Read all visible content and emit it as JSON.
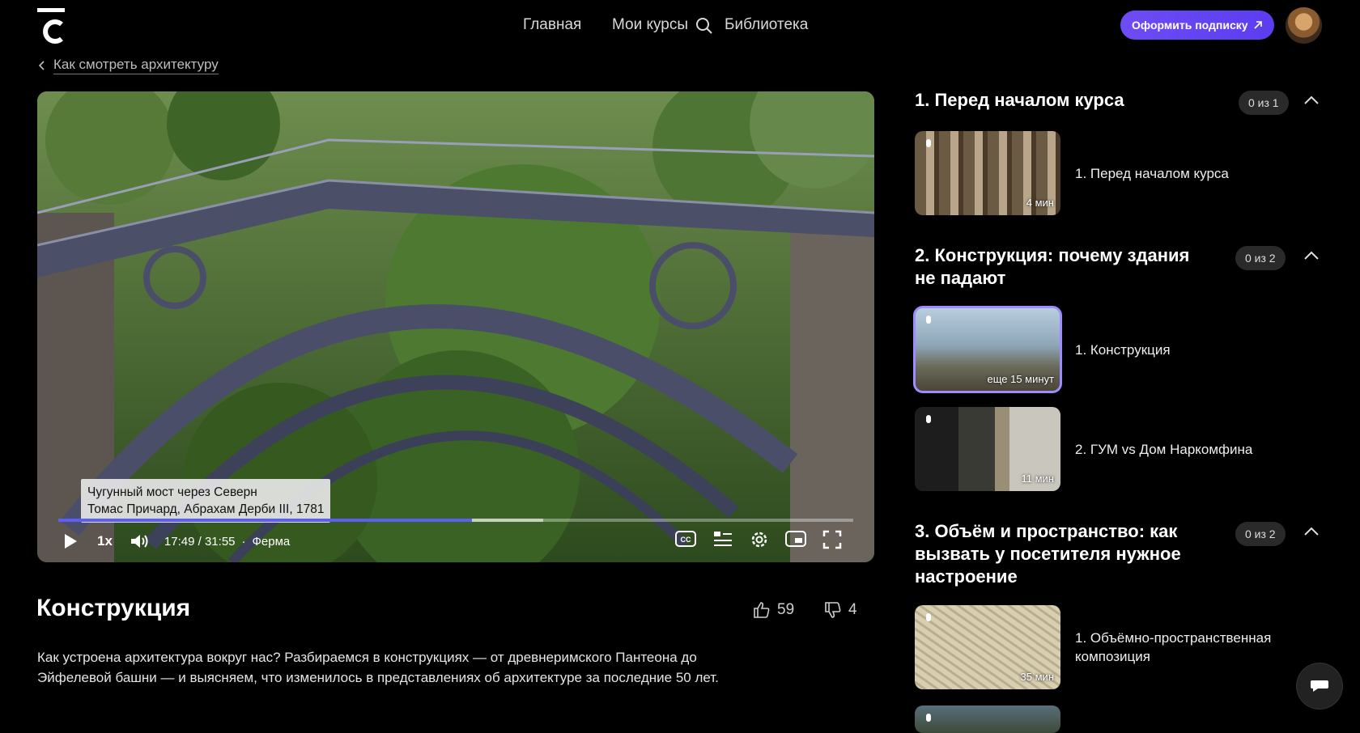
{
  "header": {
    "nav": {
      "home": "Главная",
      "my_courses": "Мои курсы",
      "library": "Библиотека"
    },
    "subscribe_label": "Оформить подписку"
  },
  "breadcrumb": {
    "back_label": "Как смотреть архитектуру"
  },
  "video": {
    "caption_line1": "Чугунный мост через Северн",
    "caption_line2": "Томас Причард, Абрахам Дерби III, 1781",
    "speed": "1x",
    "time": "17:49 / 31:55",
    "chapter": "Ферма",
    "progress": 0.52,
    "buffered": 0.61
  },
  "lesson": {
    "title": "Конструкция",
    "likes": "59",
    "dislikes": "4",
    "description": "Как устроена архитектура вокруг нас? Разбираемся в конструкциях — от древнеримского Пантеона до Эйфелевой башни — и выясняем, что изменилось в представлениях об архитектуре за последние 50 лет."
  },
  "sections": [
    {
      "title": "1. Перед началом курса",
      "count": "0 из 1",
      "items": [
        {
          "label": "1. Перед началом курса",
          "duration": "4 мин"
        }
      ]
    },
    {
      "title": "2. Конструкция: почему здания не падают",
      "count": "0 из 2",
      "items": [
        {
          "label": "1. Конструкция",
          "duration": "еще 15 минут"
        },
        {
          "label": "2. ГУМ vs Дом Наркомфина",
          "duration": "11 мин"
        }
      ]
    },
    {
      "title": "3. Объём и пространство: как вызвать у посетителя нужное настроение",
      "count": "0 из 2",
      "items": [
        {
          "label": "1. Объёмно-пространственная композиция",
          "duration": "35 мин"
        }
      ]
    }
  ],
  "colors": {
    "accent": "#5b3df0",
    "progress": "#5b5ff5",
    "active_outline": "#9d8cff"
  }
}
